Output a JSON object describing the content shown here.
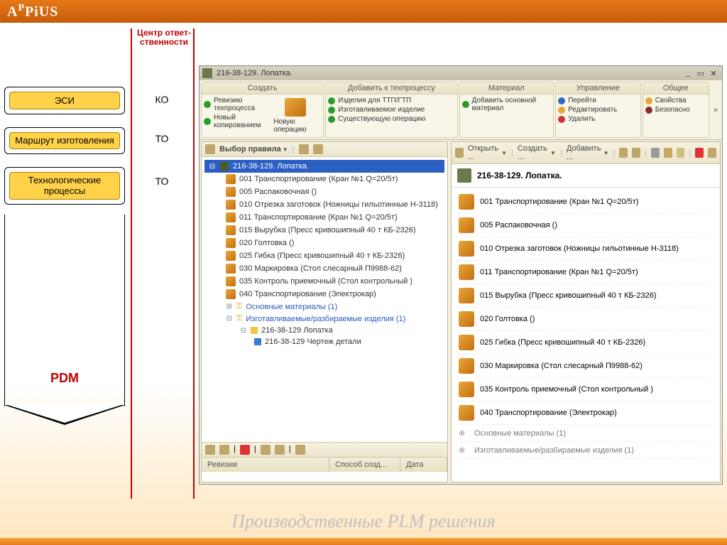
{
  "logo": "APPiUS",
  "sidebar": {
    "center_header": "Центр ответ-ственности",
    "boxes": [
      {
        "label": "ЭСИ",
        "resp": "КО"
      },
      {
        "label": "Маршрут изготовления",
        "resp": "ТО"
      },
      {
        "label": "Технологические процессы",
        "resp": "ТО"
      }
    ],
    "pdm": "PDM"
  },
  "app": {
    "title": "216-38-129. Лопатка.",
    "ribbon": {
      "groups": {
        "create": {
          "title": "Создать",
          "items": [
            "Ревизию техпроцесса",
            "Новый копированием"
          ],
          "big_btn": "Новую операцию"
        },
        "add": {
          "title": "Добавить к техпроцессу",
          "items": [
            "Изделия для ТТП/ГТП",
            "Изготавливаемое изделие",
            "Существующую операцию"
          ]
        },
        "material": {
          "title": "Материал",
          "items": [
            "Добавить основной материал"
          ]
        },
        "manage": {
          "title": "Управление",
          "items": [
            "Перейти",
            "Редактировать",
            "Удалить"
          ]
        },
        "general": {
          "title": "Общее",
          "items": [
            "Свойства",
            "Безопасно"
          ]
        }
      }
    },
    "left_panel": {
      "rule_label": "Выбор правила",
      "root": "216-38-129. Лопатка.",
      "ops": [
        "001 Транспортирование (Кран №1 Q=20/5т)",
        "005 Распаковочная ()",
        "010 Отрезка заготовок (Ножницы гильотинные Н-3118)",
        "011 Транспортирование (Кран №1 Q=20/5т)",
        "015 Вырубка (Пресс кривошипный 40 т КБ-2326)",
        "020 Голтовка ()",
        "025 Гибка (Пресс кривошипный 40 т КБ-2326)",
        "030 Маркировка (Стол слесарный П9988-62)",
        "035 Контроль приемочный (Стол контрольный )",
        "040 Транспортирование (Электрокар)"
      ],
      "links": {
        "materials": "Основные материалы (1)",
        "products": "Изготавливаемые/разбираемые изделия (1)"
      },
      "nested": [
        "216-38-129 Лопатка",
        "216-38-129 Чертеж детали"
      ],
      "table_cols": {
        "c1": "Ревизии",
        "c2": "Способ созд...",
        "c3": "Дата"
      }
    },
    "right_panel": {
      "tb": {
        "open": "Открыть ...",
        "create": "Создать ...",
        "add": "Добавить ..."
      },
      "head": "216-38-129. Лопатка.",
      "ops": [
        "001 Транспортирование (Кран №1 Q=20/5т)",
        "005 Распаковочная ()",
        "010 Отрезка заготовок (Ножницы гильотинные Н-3118)",
        "011 Транспортирование (Кран №1 Q=20/5т)",
        "015 Вырубка (Пресс кривошипный 40 т КБ-2326)",
        "020 Голтовка ()",
        "025 Гибка (Пресс кривошипный 40 т КБ-2326)",
        "030 Маркировка (Стол слесарный П9988-62)",
        "035 Контроль приемочный (Стол контрольный )",
        "040 Транспортирование (Электрокар)"
      ],
      "bottom_links": [
        "Основные материалы (1)",
        "Изготавливаемые/разбираемые изделия (1)"
      ]
    }
  },
  "footer": "Производственные PLM решения"
}
